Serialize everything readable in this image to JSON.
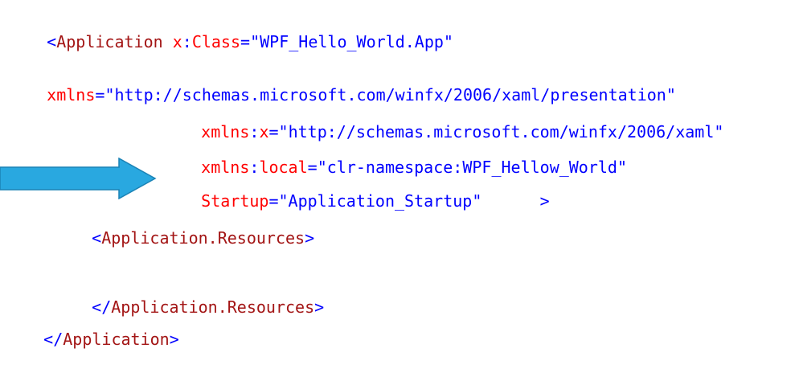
{
  "code": {
    "line1": {
      "open": "<",
      "element": "Application",
      "attr_prefix": "x",
      "colon": ":",
      "attr_name": "Class",
      "eq": "=",
      "value": "\"WPF_Hello_World.App\""
    },
    "line2": {
      "attr_name": "xmlns",
      "eq": "=",
      "value": "\"http://schemas.microsoft.com/winfx/2006/xaml/presentation\""
    },
    "line3": {
      "attr_prefix": "xmlns",
      "colon": ":",
      "attr_name": "x",
      "eq": "=",
      "value": "\"http://schemas.microsoft.com/winfx/2006/xaml\""
    },
    "line4": {
      "attr_prefix": "xmlns",
      "colon": ":",
      "attr_name": "local",
      "eq": "=",
      "value": "\"clr-namespace:WPF_Hellow_World\""
    },
    "line5": {
      "attr_name": "Startup",
      "eq": "=",
      "value": "\"Application_Startup\"",
      "close": ">"
    },
    "line6": {
      "open": "<",
      "element": "Application.Resources",
      "close": ">"
    },
    "line7": {
      "open": "</",
      "element": "Application.Resources",
      "close": ">"
    },
    "line8": {
      "open": "</",
      "element": "Application",
      "close": ">"
    }
  },
  "colors": {
    "element": "#a31515",
    "attribute": "#ff0000",
    "punctuation": "#0000ff",
    "arrow_fill": "#29a8e0",
    "arrow_stroke": "#1a82b5"
  },
  "icons": {
    "arrow": "right-arrow-icon"
  }
}
